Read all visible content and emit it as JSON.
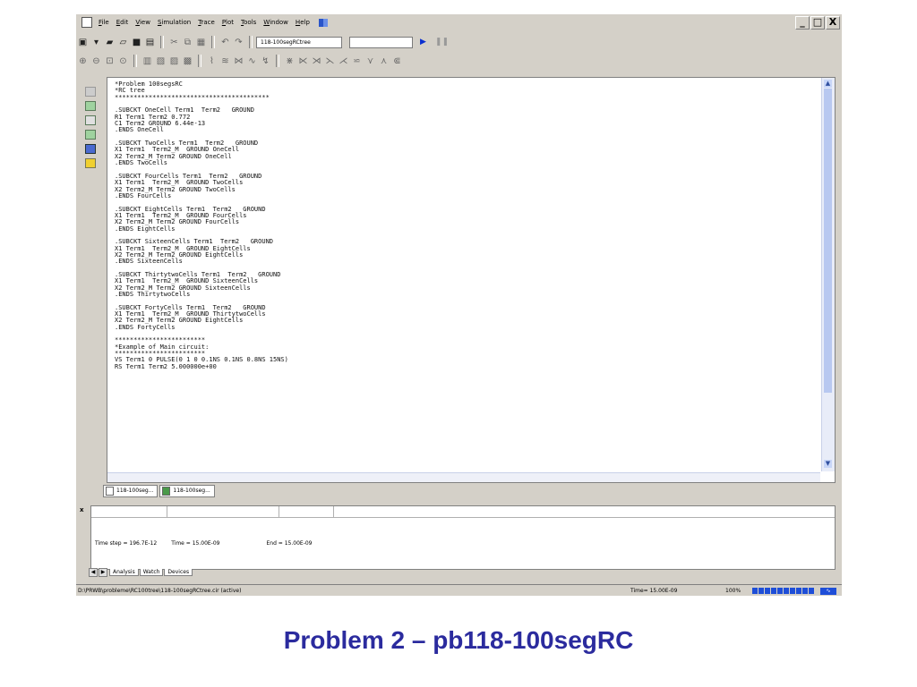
{
  "menubar": {
    "items": [
      "File",
      "Edit",
      "View",
      "Simulation",
      "Trace",
      "Plot",
      "Tools",
      "Window",
      "Help"
    ]
  },
  "window_controls": {
    "minimize": "_",
    "maximize": "□",
    "close": "X"
  },
  "toolbar": {
    "file_combo_value": "118-100segRCtree",
    "second_combo_value": ""
  },
  "editor": {
    "code": "*Problem 100segsRC\n*RC tree\n*****************************************\n\n.SUBCKT OneCell Term1  Term2   GROUND\nR1 Term1 Term2 0.772\nC1 Term2 GROUND 6.44e-13\n.ENDS OneCell\n\n.SUBCKT TwoCells Term1  Term2   GROUND\nX1 Term1  Term2_M  GROUND OneCell\nX2 Term2_M Term2 GROUND OneCell\n.ENDS TwoCells\n\n.SUBCKT FourCells Term1  Term2   GROUND\nX1 Term1  Term2_M  GROUND TwoCells\nX2 Term2_M Term2 GROUND TwoCells\n.ENDS FourCells\n\n.SUBCKT EightCells Term1  Term2   GROUND\nX1 Term1  Term2_M  GROUND FourCells\nX2 Term2_M Term2 GROUND FourCells\n.ENDS EightCells\n\n.SUBCKT SixteenCells Term1  Term2   GROUND\nX1 Term1  Term2_M  GROUND EightCells\nX2 Term2_M Term2 GROUND EightCells\n.ENDS SixteenCells\n\n.SUBCKT ThirtytwoCells Term1  Term2   GROUND\nX1 Term1  Term2_M  GROUND SixteenCells\nX2 Term2_M Term2 GROUND SixteenCells\n.ENDS ThirtytwoCells\n\n.SUBCKT FortyCells Term1  Term2   GROUND\nX1 Term1  Term2_M  GROUND ThirtytwoCells\nX2 Term2_M Term2 GROUND EightCells\n.ENDS FortyCells\n\n************************\n*Example of Main circuit:\n************************\nVS Term1 0 PULSE(0 1 0 0.1NS 0.1NS 0.8NS 15NS)\nRS Term1 Term2 5.000000e+00"
  },
  "doc_tabs": [
    "118-100seg...",
    "118-100seg..."
  ],
  "panel": {
    "close_label": "x",
    "time_step": "Time step = 196.7E-12",
    "time": "Time = 15.00E-09",
    "end": "End = 15.00E-09",
    "tabs": [
      "Analysis",
      "Watch",
      "Devices"
    ]
  },
  "statusbar": {
    "path": "D:\\PRWB\\probleme\\RC100tree\\118-100segRCtree.cir (active)",
    "time": "Time= 15.00E-09",
    "zoom": "100%"
  },
  "caption": "Problem 2 – pb118-100segRC"
}
